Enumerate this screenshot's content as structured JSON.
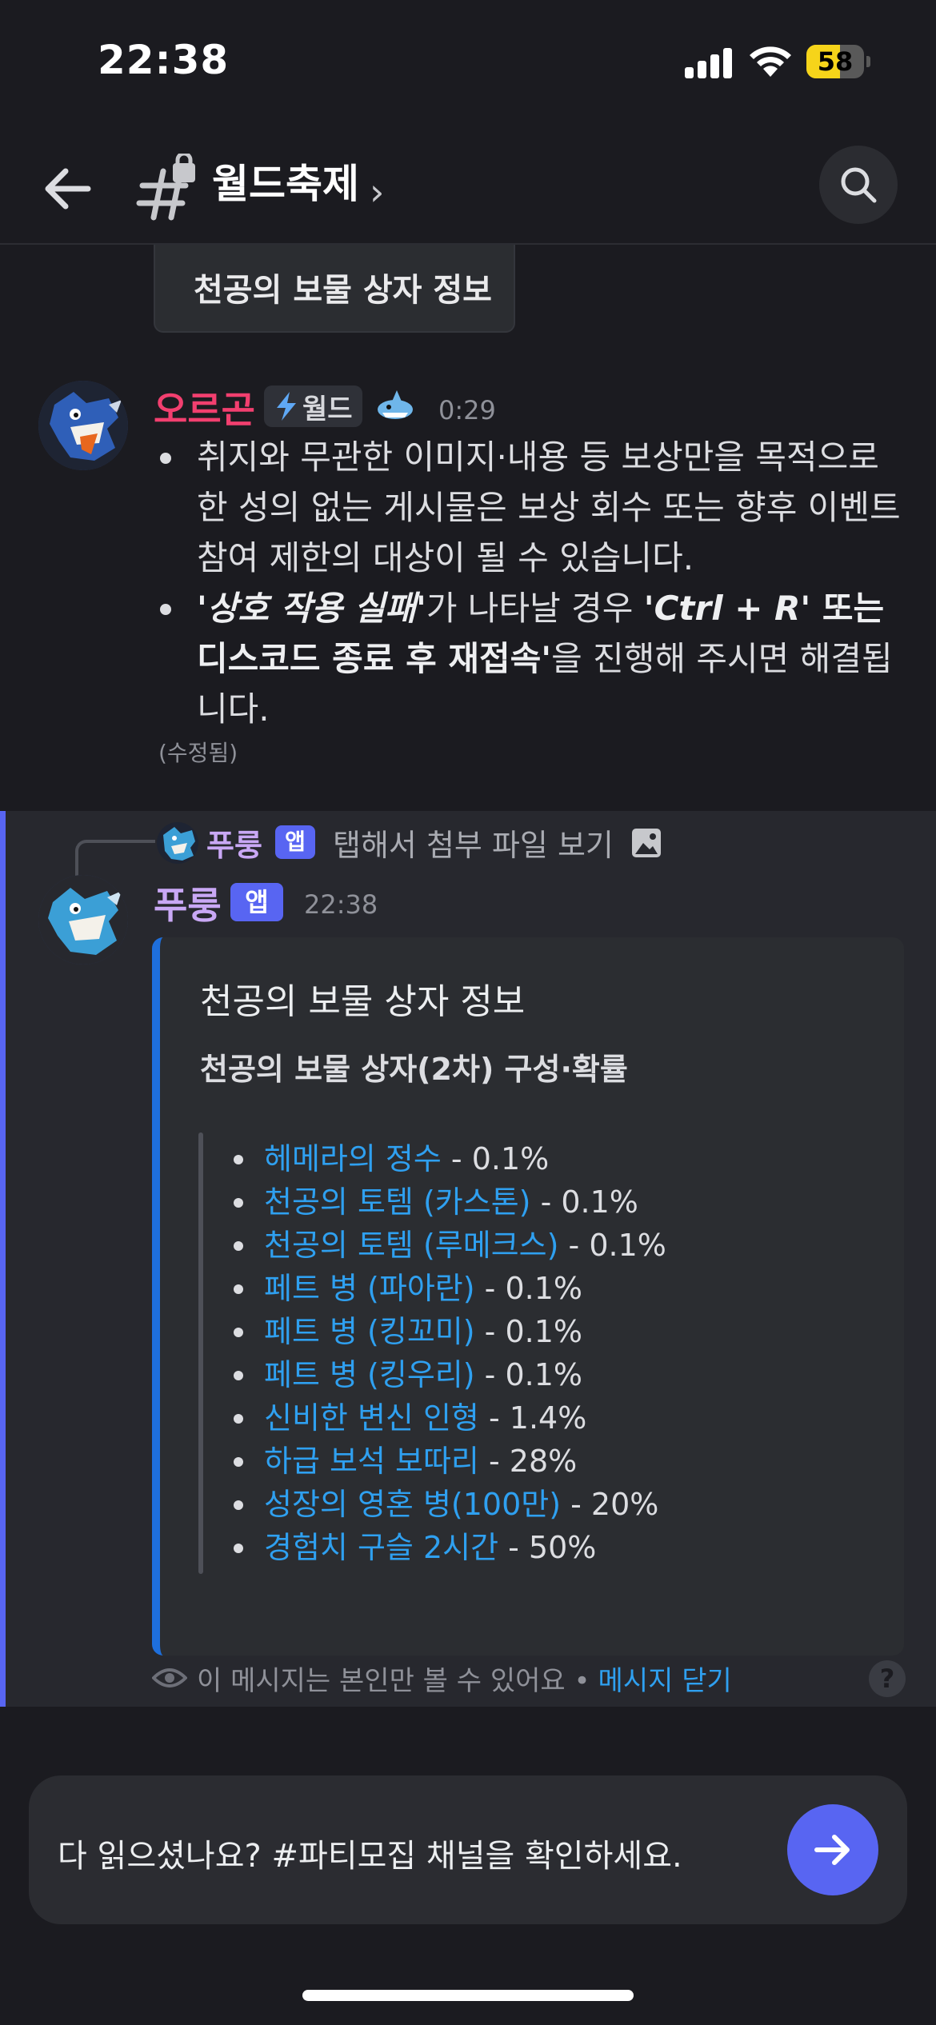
{
  "status_bar": {
    "time": "22:38",
    "battery": "58",
    "battery_level": 0.58
  },
  "header": {
    "channel_name": "월드축제",
    "chevron": "›",
    "back_icon": "back-arrow-icon",
    "search_icon": "search-icon"
  },
  "prev_embed": {
    "title": "천공의 보물 상자 정보"
  },
  "message1": {
    "author": "오르곤",
    "author_color": "#f23f6f",
    "role_tag": "월드",
    "timestamp": "0:29",
    "bullet1": "취지와 무관한 이미지·내용 등 보상만을 목적으로 한 성의 없는 게시물은 보상 회수 또는 향후 이벤트 참여 제한의 대상이 될 수 있습니다.",
    "bullet2": {
      "part1_bold": "'상호 작용 실패'",
      "part2": "가 나타날 경우 ",
      "part3_bold": "'Ctrl + R'",
      "part4_bold": " 또는 디스코드 종료 후 재접속",
      "part5_bold": "'",
      "part6": "을 진행해 주시면 해결됩니다."
    },
    "edited": "(수정됨)"
  },
  "reply": {
    "name": "푸룽",
    "badge": "앱",
    "text": "탭해서 첨부 파일 보기"
  },
  "message2": {
    "author": "푸룽",
    "author_color": "#c9a8f5",
    "badge": "앱",
    "timestamp": "22:38",
    "embed": {
      "accent": "#1e6fdc",
      "title": "천공의 보물 상자 정보",
      "subtitle": "천공의 보물 상자(2차) 구성·확률",
      "items": [
        {
          "name": "헤메라의 정수",
          "rate": " - 0.1%"
        },
        {
          "name": "천공의 토템 (카스톤)",
          "rate": " - 0.1%"
        },
        {
          "name": "천공의 토템 (루메크스)",
          "rate": " - 0.1%"
        },
        {
          "name": "페트 병 (파아란)",
          "rate": " - 0.1%"
        },
        {
          "name": "페트 병 (킹꼬미)",
          "rate": " - 0.1%"
        },
        {
          "name": "페트 병 (킹우리)",
          "rate": " - 0.1%"
        },
        {
          "name": "신비한 변신 인형",
          "rate": " - 1.4%"
        },
        {
          "name": "하급 보석 보따리",
          "rate": " - 28%"
        },
        {
          "name": "성장의 영혼 병(100만)",
          "rate": " - 20%"
        },
        {
          "name": "경험치 구슬 2시간",
          "rate": " - 50%"
        }
      ]
    },
    "ephemeral_note": "이 메시지는 본인만 볼 수 있어요 •",
    "dismiss": "메시지 닫기",
    "help": "?"
  },
  "input": {
    "text": "다 읽으셨나요? #파티모집 채널을 확인하세요.",
    "send_icon": "send-arrow-icon"
  }
}
